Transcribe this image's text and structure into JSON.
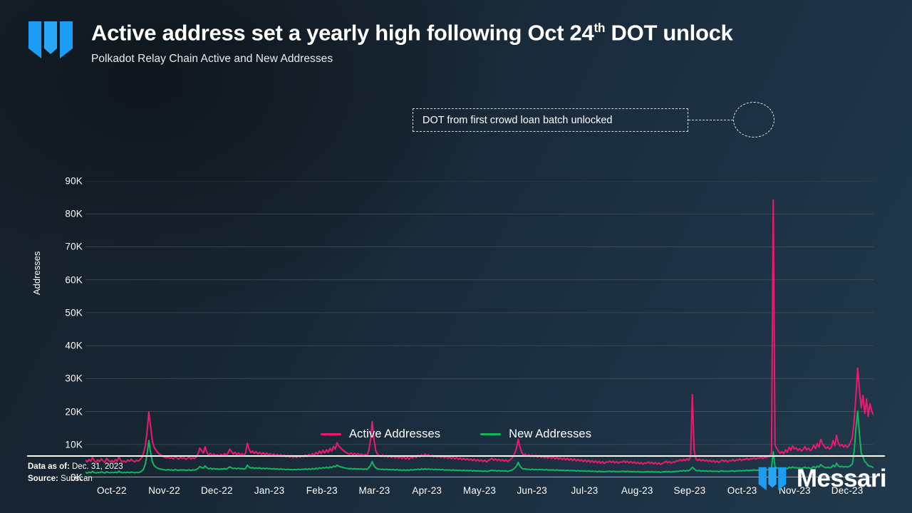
{
  "header": {
    "logo_icon": "messari-logo-icon",
    "title_main": "Active address set a yearly high following Oct 24",
    "title_sup": "th",
    "title_tail": " DOT unlock",
    "subtitle": "Polkadot Relay Chain Active and New Addresses"
  },
  "annotation": {
    "text": "DOT from first crowd loan batch unlocked"
  },
  "legend": [
    {
      "label": "Active Addresses",
      "color": "#EC1A6F"
    },
    {
      "label": "New Addresses",
      "color": "#10B75C"
    }
  ],
  "footer": {
    "data_as_of_label": "Data as of:",
    "data_as_of_value": " Dec. 31, 2023",
    "source_label": "Source:",
    "source_value": " Subscan",
    "brand": "Messari",
    "brand_icon": "messari-logo-icon"
  },
  "chart_data": {
    "type": "line",
    "title": "Active address set a yearly high following Oct 24th DOT unlock",
    "subtitle": "Polkadot Relay Chain Active and New Addresses",
    "xlabel": "",
    "ylabel": "Addresses",
    "ylim": [
      0,
      90000
    ],
    "ytick_labels": [
      "0K",
      "10K",
      "20K",
      "30K",
      "40K",
      "50K",
      "60K",
      "70K",
      "80K",
      "90K"
    ],
    "ytick_values": [
      0,
      10000,
      20000,
      30000,
      40000,
      50000,
      60000,
      70000,
      80000,
      90000
    ],
    "xtick_labels": [
      "Oct-22",
      "Nov-22",
      "Dec-22",
      "Jan-23",
      "Feb-23",
      "Mar-23",
      "Apr-23",
      "May-23",
      "Jun-23",
      "Jul-23",
      "Aug-23",
      "Sep-23",
      "Oct-23",
      "Nov-23",
      "Dec-23"
    ],
    "grid": "horizontal",
    "legend_position": "bottom-center",
    "annotations": [
      {
        "text": "DOT from first crowd loan batch unlocked",
        "points_to": "2023-10-24 spike",
        "value": 84000
      }
    ],
    "series": [
      {
        "name": "Active Addresses",
        "color": "#EC1A6F",
        "values": [
          5200,
          4700,
          5400,
          4900,
          6100,
          5000,
          4600,
          5300,
          4800,
          5600,
          5000,
          4500,
          5800,
          5200,
          4700,
          5100,
          4600,
          5400,
          4900,
          6300,
          5200,
          4700,
          5000,
          4600,
          5300,
          4900,
          5500,
          5000,
          4700,
          5200,
          4900,
          5400,
          6000,
          7400,
          9600,
          13800,
          19900,
          15500,
          11000,
          9200,
          8300,
          7600,
          7100,
          6800,
          6400,
          6100,
          5900,
          6300,
          5800,
          6000,
          5600,
          6400,
          5900,
          5500,
          6200,
          5700,
          6000,
          5500,
          5800,
          6200,
          5600,
          6000,
          5700,
          6300,
          7200,
          8900,
          8100,
          7400,
          9300,
          7600,
          6800,
          7300,
          6600,
          7100,
          6500,
          6900,
          6400,
          7000,
          6500,
          7200,
          6700,
          7400,
          8600,
          7800,
          7100,
          7600,
          6900,
          7400,
          6800,
          7200,
          6700,
          7300,
          10400,
          8600,
          7500,
          8000,
          7300,
          7800,
          7100,
          7600,
          7000,
          7500,
          6900,
          7400,
          6800,
          7200,
          6600,
          7100,
          6500,
          7000,
          6400,
          6900,
          6300,
          6800,
          6200,
          6700,
          6100,
          6600,
          6000,
          6500,
          6000,
          6500,
          6100,
          6600,
          6200,
          6800,
          6300,
          7000,
          6400,
          7200,
          6600,
          7600,
          7000,
          8000,
          7200,
          8200,
          7400,
          8400,
          7600,
          8800,
          8000,
          9400,
          8600,
          10500,
          9500,
          9000,
          8400,
          8000,
          7600,
          7300,
          7000,
          7400,
          6900,
          7300,
          6800,
          7200,
          6700,
          7100,
          6600,
          7000,
          6500,
          8100,
          11200,
          16900,
          11500,
          8200,
          7000,
          6600,
          6300,
          6800,
          6200,
          6700,
          6100,
          6600,
          6000,
          6500,
          5900,
          6400,
          5800,
          6300,
          5700,
          6200,
          5600,
          6100,
          5500,
          6300,
          5800,
          6500,
          6000,
          6700,
          6200,
          6900,
          6300,
          7100,
          6500,
          6900,
          6300,
          6700,
          6200,
          6600,
          6100,
          6500,
          6000,
          6400,
          5900,
          6300,
          5800,
          6200,
          5700,
          6100,
          5600,
          6000,
          5500,
          5900,
          5400,
          5800,
          5300,
          5700,
          5200,
          5600,
          5100,
          5500,
          5000,
          5400,
          4900,
          5300,
          4800,
          5200,
          4700,
          5100,
          5400,
          5800,
          5200,
          5600,
          5100,
          5500,
          5000,
          5400,
          4900,
          5300,
          4800,
          5200,
          5600,
          6200,
          7300,
          8800,
          11600,
          9200,
          7600,
          6600,
          7100,
          6400,
          6900,
          6300,
          6800,
          6200,
          6700,
          6100,
          6600,
          6000,
          6500,
          5900,
          6400,
          5800,
          6300,
          5700,
          6200,
          5600,
          6100,
          5500,
          6000,
          5400,
          5900,
          5300,
          5800,
          5200,
          5700,
          5100,
          5600,
          5000,
          5500,
          4900,
          5400,
          4800,
          5300,
          4700,
          5200,
          4600,
          5100,
          4500,
          5000,
          4400,
          4900,
          4300,
          4800,
          4200,
          4700,
          4600,
          5000,
          4500,
          4900,
          4400,
          4800,
          4300,
          4700,
          4600,
          5000,
          4500,
          4900,
          4400,
          4800,
          4300,
          4700,
          4200,
          4600,
          4100,
          4500,
          4000,
          4400,
          4300,
          4700,
          4200,
          4600,
          4100,
          4500,
          4000,
          4400,
          3900,
          4300,
          4500,
          4900,
          4400,
          4800,
          4300,
          4700,
          4600,
          5000,
          4900,
          5400,
          5000,
          5500,
          5100,
          5600,
          5200,
          6400,
          25100,
          8400,
          5600,
          5100,
          5500,
          5000,
          5400,
          4900,
          5300,
          4800,
          5200,
          4700,
          5100,
          4600,
          5000,
          4500,
          4900,
          5300,
          4800,
          5200,
          4700,
          5100,
          5000,
          5400,
          4900,
          5300,
          5200,
          5600,
          5100,
          5500,
          5400,
          5800,
          5300,
          5700,
          5600,
          6000,
          5500,
          5900,
          5800,
          6200,
          5700,
          6100,
          6000,
          6400,
          6300,
          7400,
          84200,
          9800,
          8800,
          7900,
          7300,
          7800,
          7200,
          8400,
          7600,
          9200,
          8200,
          9600,
          8600,
          9000,
          8200,
          8700,
          8000,
          8500,
          9400,
          8300,
          8900,
          8100,
          8600,
          9800,
          8700,
          10300,
          9200,
          11600,
          10200,
          9400,
          8800,
          9300,
          8600,
          9100,
          11200,
          9600,
          12800,
          10400,
          9500,
          10000,
          9200,
          9800,
          9100,
          9600,
          10800,
          12200,
          17400,
          24800,
          33200,
          26500,
          21200,
          24900,
          19400,
          23800,
          18600,
          22400,
          20100,
          19000
        ]
      },
      {
        "name": "New Addresses",
        "color": "#10B75C",
        "values": [
          1500,
          1300,
          1600,
          1400,
          1800,
          1500,
          1300,
          1500,
          1400,
          1700,
          1500,
          1300,
          1700,
          1500,
          1400,
          1500,
          1400,
          1600,
          1400,
          1900,
          1500,
          1400,
          1500,
          1400,
          1600,
          1400,
          1600,
          1500,
          1400,
          1500,
          1450,
          1600,
          1900,
          2500,
          4000,
          7000,
          11200,
          7500,
          4800,
          3600,
          3100,
          2800,
          2600,
          2500,
          2400,
          2300,
          2200,
          2400,
          2200,
          2300,
          2100,
          2400,
          2200,
          2100,
          2300,
          2200,
          2300,
          2100,
          2200,
          2300,
          2100,
          2300,
          2200,
          2400,
          2700,
          3300,
          3000,
          2800,
          3500,
          2900,
          2600,
          2800,
          2500,
          2700,
          2500,
          2600,
          2400,
          2600,
          2500,
          2700,
          2500,
          2800,
          3200,
          2900,
          2700,
          2800,
          2600,
          2800,
          2600,
          2700,
          2500,
          2700,
          3700,
          3100,
          2800,
          3000,
          2700,
          2900,
          2700,
          2900,
          2600,
          2800,
          2600,
          2800,
          2600,
          2700,
          2500,
          2700,
          2500,
          2600,
          2400,
          2600,
          2400,
          2500,
          2300,
          2500,
          2300,
          2400,
          2300,
          2400,
          2300,
          2500,
          2300,
          2500,
          2400,
          2600,
          2400,
          2600,
          2400,
          2700,
          2500,
          2800,
          2600,
          2900,
          2700,
          3000,
          2800,
          3100,
          2800,
          3200,
          3000,
          3400,
          3200,
          3700,
          3400,
          3200,
          3100,
          2900,
          2800,
          2700,
          2600,
          2700,
          2500,
          2700,
          2500,
          2600,
          2500,
          2600,
          2400,
          2600,
          2400,
          2900,
          3600,
          4800,
          3600,
          2900,
          2600,
          2500,
          2400,
          2500,
          2300,
          2500,
          2300,
          2400,
          2300,
          2400,
          2200,
          2400,
          2200,
          2300,
          2100,
          2300,
          2100,
          2300,
          2100,
          2400,
          2200,
          2400,
          2300,
          2500,
          2300,
          2600,
          2400,
          2600,
          2400,
          2600,
          2400,
          2500,
          2300,
          2500,
          2300,
          2400,
          2300,
          2400,
          2200,
          2300,
          2200,
          2300,
          2100,
          2300,
          2100,
          2200,
          2100,
          2200,
          2000,
          2200,
          2000,
          2100,
          2000,
          2100,
          1900,
          2100,
          1900,
          2000,
          1900,
          2000,
          1800,
          2000,
          1800,
          1900,
          2000,
          2200,
          2000,
          2100,
          1900,
          2100,
          1900,
          2000,
          1900,
          2000,
          1800,
          2000,
          2100,
          2400,
          2800,
          3400,
          4600,
          3400,
          2800,
          2500,
          2600,
          2400,
          2500,
          2300,
          2500,
          2300,
          2400,
          2300,
          2400,
          2300,
          2400,
          2200,
          2400,
          2200,
          2300,
          2200,
          2300,
          2100,
          2300,
          2100,
          2200,
          2100,
          2200,
          2000,
          2200,
          2000,
          2100,
          2000,
          2100,
          1900,
          2100,
          1900,
          2000,
          1900,
          2000,
          1800,
          2000,
          1800,
          1900,
          1800,
          1900,
          1700,
          1900,
          1700,
          1800,
          1700,
          1800,
          1800,
          1900,
          1700,
          1900,
          1700,
          1800,
          1700,
          1800,
          1800,
          1900,
          1700,
          1900,
          1700,
          1800,
          1700,
          1800,
          1600,
          1800,
          1600,
          1700,
          1600,
          1700,
          1700,
          1800,
          1600,
          1800,
          1600,
          1700,
          1600,
          1700,
          1500,
          1700,
          1700,
          1800,
          1700,
          1800,
          1600,
          1800,
          1700,
          1900,
          1800,
          2000,
          1900,
          2100,
          1900,
          2100,
          2000,
          2400,
          3100,
          2600,
          2100,
          2000,
          2100,
          1900,
          2000,
          1900,
          2000,
          1800,
          2000,
          1800,
          1900,
          1800,
          1900,
          1700,
          1900,
          2000,
          1800,
          1900,
          1800,
          1900,
          1900,
          2000,
          1800,
          2000,
          1900,
          2100,
          1900,
          2100,
          2000,
          2200,
          2000,
          2200,
          2100,
          2300,
          2100,
          2200,
          2200,
          2300,
          2100,
          2300,
          2200,
          2400,
          2400,
          2800,
          7800,
          3200,
          2900,
          2600,
          2500,
          2600,
          2400,
          2800,
          2600,
          3100,
          2800,
          3200,
          2900,
          3000,
          2800,
          2900,
          2700,
          2900,
          3100,
          2800,
          3000,
          2700,
          2900,
          3300,
          2900,
          3400,
          3100,
          3900,
          3400,
          3100,
          2900,
          3100,
          2900,
          3000,
          3700,
          3200,
          4300,
          3500,
          3200,
          3400,
          3100,
          3300,
          3100,
          3300,
          3600,
          4100,
          8000,
          14800,
          20100,
          13200,
          7400,
          6200,
          4800,
          4300,
          3600,
          3400,
          3200,
          3000
        ]
      }
    ]
  }
}
